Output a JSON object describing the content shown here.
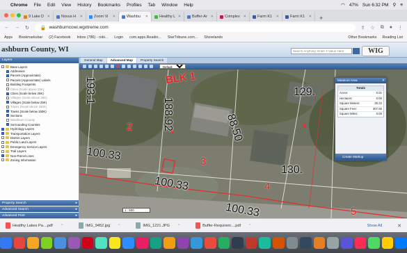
{
  "menubar": {
    "app": "Chrome",
    "items": [
      "File",
      "Edit",
      "View",
      "History",
      "Bookmarks",
      "Profiles",
      "Tab",
      "Window",
      "Help"
    ],
    "battery": "47%",
    "clock": "Sun 6:32 PM"
  },
  "tabs": [
    {
      "label": "9 Lake D",
      "color": "#d9822b"
    },
    {
      "label": "Novus H",
      "color": "#4a79c7"
    },
    {
      "label": "Zoom Vi",
      "color": "#2d8cff"
    },
    {
      "label": "Washbu",
      "color": "#4a79c7",
      "active": true
    },
    {
      "label": "Healthy L",
      "color": "#4caf50"
    },
    {
      "label": "Buffer-Ar",
      "color": "#4a79c7"
    },
    {
      "label": "Complex",
      "color": "#c2185b"
    },
    {
      "label": "Farm K1",
      "color": "#3b5998"
    },
    {
      "label": "Farm K1",
      "color": "#3b5998"
    }
  ],
  "address": {
    "url": "washburncowi.wgxtreme.com"
  },
  "bookmarks": {
    "items": [
      "Apps",
      "Bookmarksbar",
      "(2) Facebook",
      "Inbox (786) - robi...",
      "Login",
      "com.apps.Readin...",
      "StarTribune.com...",
      "Shorelands"
    ],
    "right": [
      "Other Bookmarks",
      "Reading List"
    ]
  },
  "site": {
    "title": "ashburn County, WI",
    "search_placeholder": "Search Anything: Enter 4 Value Here",
    "logo": "WIG"
  },
  "sidebar": {
    "header": "Layers",
    "layers": [
      {
        "label": "Base Layers",
        "indent": 0,
        "on": false,
        "folder": true,
        "dim": false
      },
      {
        "label": "Addresses",
        "indent": 1,
        "on": true,
        "folder": false,
        "dim": false
      },
      {
        "label": "Parcels (Approximate)",
        "indent": 1,
        "on": true,
        "folder": false,
        "dim": false
      },
      {
        "label": "Parcels (Approximate) Labels",
        "indent": 1,
        "on": false,
        "folder": false,
        "dim": false
      },
      {
        "label": "Building Footprints",
        "indent": 1,
        "on": false,
        "folder": false,
        "dim": false
      },
      {
        "label": "Cities (Scale above 25K)",
        "indent": 1,
        "on": false,
        "folder": false,
        "dim": true
      },
      {
        "label": "Cities (Scale below 25K)",
        "indent": 1,
        "on": true,
        "folder": false,
        "dim": false
      },
      {
        "label": "Villages (Scale above 25K)",
        "indent": 1,
        "on": false,
        "folder": false,
        "dim": true
      },
      {
        "label": "Villages (Scale below 25K)",
        "indent": 1,
        "on": true,
        "folder": false,
        "dim": false
      },
      {
        "label": "Towns (Scale above 150K)",
        "indent": 1,
        "on": false,
        "folder": false,
        "dim": true
      },
      {
        "label": "Towns (Scale below 150K)",
        "indent": 1,
        "on": true,
        "folder": false,
        "dim": false
      },
      {
        "label": "Sections",
        "indent": 1,
        "on": true,
        "folder": false,
        "dim": false
      },
      {
        "label": "Washburn County",
        "indent": 1,
        "on": false,
        "folder": false,
        "dim": true
      },
      {
        "label": "Surrounding Counties",
        "indent": 1,
        "on": true,
        "folder": false,
        "dim": false
      },
      {
        "label": "Hydrology Layers",
        "indent": 0,
        "on": true,
        "folder": true,
        "dim": false
      },
      {
        "label": "Transportation Layers",
        "indent": 0,
        "on": true,
        "folder": true,
        "dim": false
      },
      {
        "label": "District Layers",
        "indent": 0,
        "on": false,
        "folder": true,
        "dim": false
      },
      {
        "label": "Public Land Layers",
        "indent": 0,
        "on": false,
        "folder": true,
        "dim": false
      },
      {
        "label": "Emergency Service Layers",
        "indent": 0,
        "on": false,
        "folder": true,
        "dim": false
      },
      {
        "label": "Trail Layers",
        "indent": 0,
        "on": false,
        "folder": true,
        "dim": false
      },
      {
        "label": "Non-Parcel Lines",
        "indent": 0,
        "on": true,
        "folder": true,
        "dim": false
      },
      {
        "label": "Zoning Information",
        "indent": 0,
        "on": false,
        "folder": true,
        "dim": false
      }
    ],
    "footer": [
      "Property Search",
      "Advanced Search",
      "Advanced Print"
    ]
  },
  "map": {
    "tabs": [
      "General Map",
      "Advanced Map",
      "Property Search"
    ],
    "active_tab": "Advanced Map",
    "select_value": "Default",
    "scale": "1 : 500",
    "dimensions": [
      {
        "text": "193.1",
        "rot": 90
      },
      {
        "text": "188.92",
        "rot": 90
      },
      {
        "text": "88.50",
        "rot": 72
      },
      {
        "text": "129.",
        "rot": 0
      },
      {
        "text": "100.33",
        "rot": 8
      },
      {
        "text": "100.33",
        "rot": 10
      },
      {
        "text": "100.33",
        "rot": 10
      },
      {
        "text": "130.",
        "rot": 0
      }
    ],
    "lot_numbers": [
      "2",
      "3",
      "4",
      "5"
    ],
    "block_label": "BLK 1"
  },
  "measure": {
    "title": "Measure Area",
    "totals_header": "Totals",
    "rows": [
      {
        "k": "Acres:",
        "v": "0.01"
      },
      {
        "k": "Hectares:",
        "v": "0.00"
      },
      {
        "k": "Square Meters:",
        "v": "28.22"
      },
      {
        "k": "Square Feet:",
        "v": "307.55"
      },
      {
        "k": "Square Miles:",
        "v": "0.00"
      }
    ],
    "footer": "Create Markup"
  },
  "downloads": {
    "items": [
      {
        "name": "Healthy Lakes Pa....pdf",
        "type": "pdf"
      },
      {
        "name": "IMG_9452.jpg",
        "type": "img"
      },
      {
        "name": "IMG_1221.JPG",
        "type": "img"
      },
      {
        "name": "Buffer-Requirem....pdf",
        "type": "pdf"
      }
    ],
    "show_all": "Show All"
  },
  "dock": {
    "icons": [
      "#3478f6",
      "#e8453c",
      "#f5a623",
      "#7ed321",
      "#4a90e2",
      "#9b59b6",
      "#d0021b",
      "#50e3c2",
      "#f8e71c",
      "#2d8cff",
      "#e91e63",
      "#16a085",
      "#f39c12",
      "#8e44ad",
      "#3498db",
      "#e74c3c",
      "#27ae60",
      "#2c3e50",
      "#c0392b",
      "#1abc9c",
      "#d35400",
      "#7f8c8d",
      "#34495e",
      "#e67e22",
      "#95a5a6",
      "#5856d6",
      "#ff2d55",
      "#4cd964",
      "#ffcc00",
      "#007aff"
    ]
  }
}
